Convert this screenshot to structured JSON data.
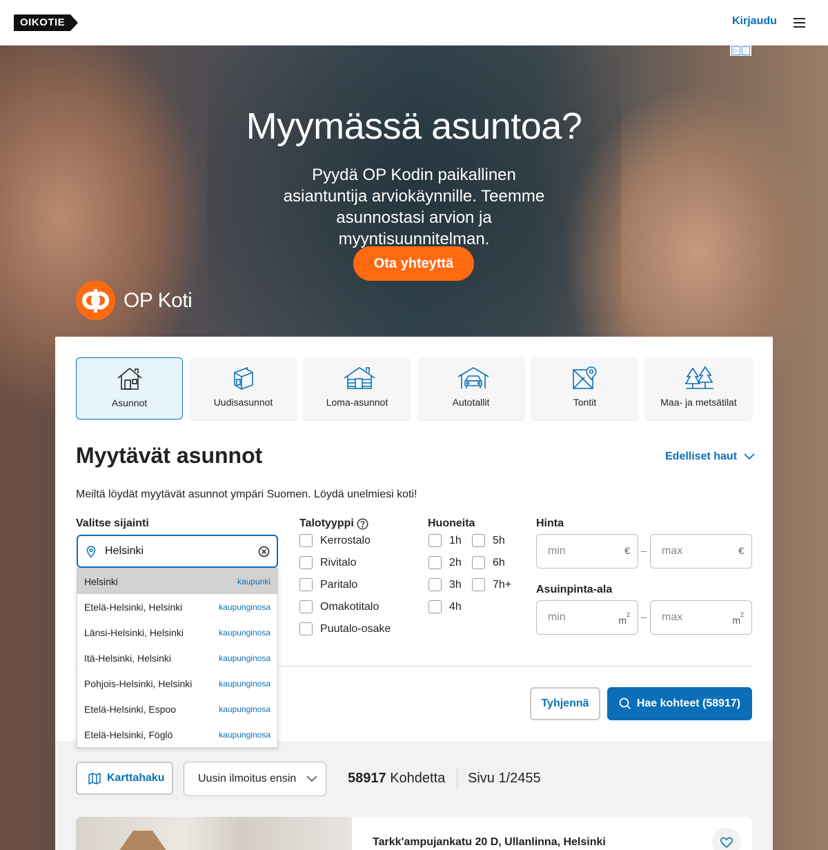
{
  "header": {
    "logo": "OIKOTIE",
    "login": "Kirjaudu"
  },
  "ad": {
    "badge": [
      "▷",
      "⋮"
    ],
    "title": "Myymässä asuntoa?",
    "subtitle": "Pyydä OP Kodin paikallinen asiantuntija arviokäynnille. Teemme asunnostasi arvion ja myyntisuunnitelman.",
    "cta": "Ota yhteyttä",
    "brand": "OP Koti",
    "brand_color": "#ff6a10"
  },
  "categories": [
    {
      "label": "Asunnot",
      "icon": "house-icon",
      "active": true
    },
    {
      "label": "Uudisasunnot",
      "icon": "new-building-icon",
      "active": false
    },
    {
      "label": "Loma-asunnot",
      "icon": "cabin-icon",
      "active": false
    },
    {
      "label": "Autotallit",
      "icon": "garage-icon",
      "active": false
    },
    {
      "label": "Tontit",
      "icon": "plot-map-icon",
      "active": false
    },
    {
      "label": "Maa- ja metsätilat",
      "icon": "trees-icon",
      "active": false
    }
  ],
  "search": {
    "title": "Myytävät asunnot",
    "previous": "Edelliset haut",
    "intro": "Meiltä löydät myytävät asunnot ympäri Suomen. Löydä unelmiesi koti!",
    "location_label": "Valitse sijainti",
    "location_value": "Helsinki",
    "house_type_label": "Talotyyppi",
    "house_types": [
      "Kerrostalo",
      "Rivitalo",
      "Paritalo",
      "Omakotitalo",
      "Puutalo-osake"
    ],
    "rooms_label": "Huoneita",
    "rooms": [
      "1h",
      "5h",
      "2h",
      "6h",
      "3h",
      "7h+",
      "4h"
    ],
    "price_label": "Hinta",
    "area_label": "Asuinpinta-ala",
    "min": "min",
    "max": "max",
    "euro": "€",
    "m2": "m",
    "sup": "2",
    "dash": "–",
    "clear": "Tyhjennä",
    "submit": "Hae kohteet (58917)"
  },
  "suggestions": [
    {
      "name": "Helsinki",
      "type": "kaupunki"
    },
    {
      "name": "Etelä-Helsinki, Helsinki",
      "type": "kaupunginosa"
    },
    {
      "name": "Länsi-Helsinki, Helsinki",
      "type": "kaupunginosa"
    },
    {
      "name": "Itä-Helsinki, Helsinki",
      "type": "kaupunginosa"
    },
    {
      "name": "Pohjois-Helsinki, Helsinki",
      "type": "kaupunginosa"
    },
    {
      "name": "Etelä-Helsinki, Espoo",
      "type": "kaupunginosa"
    },
    {
      "name": "Etelä-Helsinki, Föglö",
      "type": "kaupunginosa"
    }
  ],
  "results": {
    "map_search": "Karttahaku",
    "sort": "Uusin ilmoitus ensin",
    "count": "58917",
    "count_label": "Kohdetta",
    "page": "Sivu 1/2455",
    "first_listing": "Tarkk'ampujankatu 20 D, Ullanlinna, Helsinki"
  },
  "colors": {
    "accent": "#0b6fb8",
    "active_bg": "#e8f4fb"
  }
}
